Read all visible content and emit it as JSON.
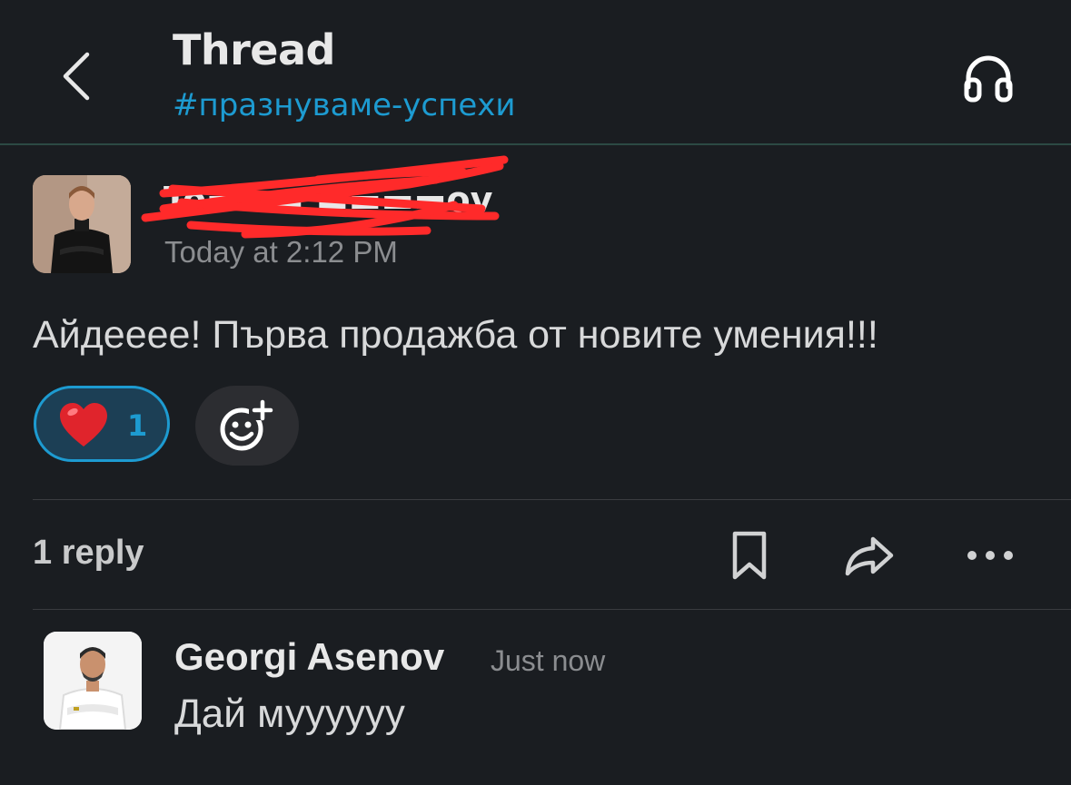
{
  "header": {
    "title": "Thread",
    "channel": "#празнуваме-успехи",
    "back_icon": "chevron-left-icon",
    "huddle_icon": "headphones-icon"
  },
  "parent_message": {
    "author_redacted": "To▬▬▬ ▬▬▬▬ov",
    "timestamp": "Today at 2:12 PM",
    "text": "Айдееее! Първа продажба от новите умения!!!",
    "reactions": [
      {
        "emoji": "❤️",
        "count": "1",
        "active": true
      }
    ],
    "add_reaction_icon": "add-emoji-icon"
  },
  "thread_bar": {
    "reply_count": "1 reply",
    "actions": [
      "bookmark-icon",
      "share-icon",
      "more-horizontal-icon"
    ]
  },
  "reply": {
    "author": "Georgi Asenov",
    "timestamp": "Just now",
    "text": "Дай муууууу"
  },
  "colors": {
    "background": "#1a1d21",
    "accent_blue": "#1d9bd1",
    "reaction_bg": "#1c3f55",
    "redaction_red": "#ff2a2a"
  }
}
